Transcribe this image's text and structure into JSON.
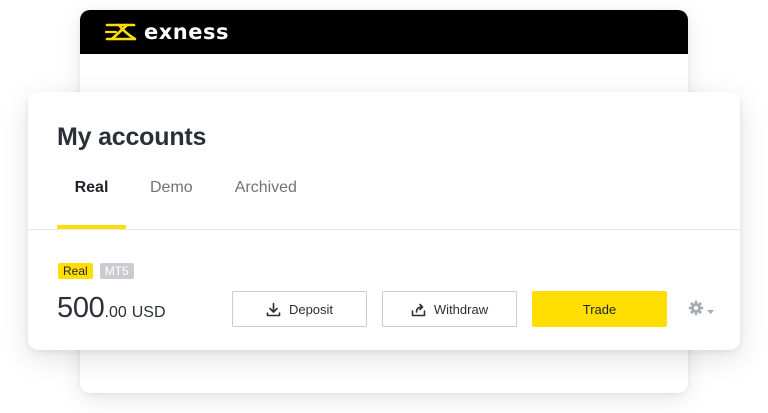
{
  "brand": {
    "name": "exness",
    "accent_color": "#ffde02",
    "header_color": "#000000"
  },
  "accounts": {
    "title": "My accounts",
    "tabs": [
      {
        "label": "Real",
        "active": true
      },
      {
        "label": "Demo",
        "active": false
      },
      {
        "label": "Archived",
        "active": false
      }
    ],
    "account": {
      "badges": [
        "Real",
        "MT5"
      ],
      "balance_integer": "500",
      "balance_decimal": ".00",
      "currency": "USD"
    },
    "actions": {
      "deposit_label": "Deposit",
      "deposit_icon": "download-icon",
      "withdraw_label": "Withdraw",
      "withdraw_icon": "share-icon",
      "trade_label": "Trade",
      "settings_icon": "gear-icon"
    }
  }
}
